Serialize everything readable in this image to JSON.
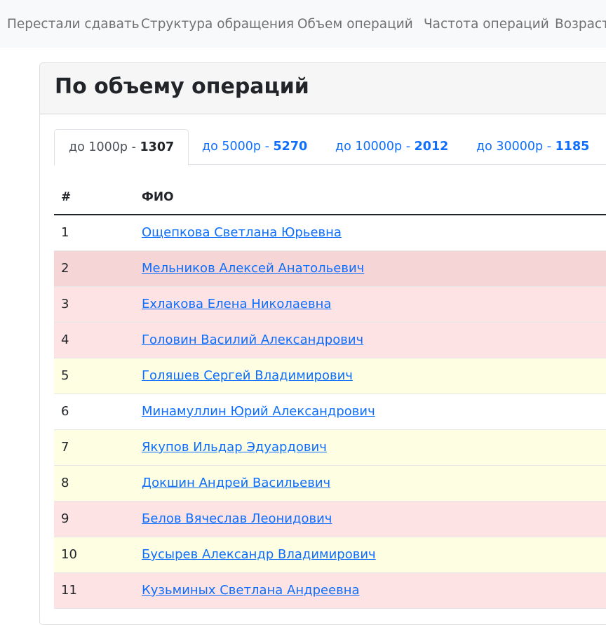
{
  "nav": {
    "items": [
      {
        "label": "Перестали сдавать"
      },
      {
        "label": "Структура обращения"
      },
      {
        "label": "Объем операций"
      },
      {
        "label": "Частота операций"
      },
      {
        "label": "Возраст"
      }
    ]
  },
  "card": {
    "title": "По объему операций"
  },
  "tabs": [
    {
      "label": "до 1000р - ",
      "count": "1307",
      "active": true
    },
    {
      "label": "до 5000р - ",
      "count": "5270",
      "active": false
    },
    {
      "label": "до 10000р - ",
      "count": "2012",
      "active": false
    },
    {
      "label": "до 30000р - ",
      "count": "1185",
      "active": false
    }
  ],
  "table": {
    "headers": [
      "#",
      "ФИО"
    ],
    "rows": [
      {
        "num": "1",
        "name": "Ощепкова Светлана Юрьевна",
        "color": "#ffffff"
      },
      {
        "num": "2",
        "name": "Мельников Алексей Анатольевич",
        "color": "#f5d5d6"
      },
      {
        "num": "3",
        "name": "Ехлакова Елена Николаевна",
        "color": "#fde3e3"
      },
      {
        "num": "4",
        "name": "Головин Василий Александрович",
        "color": "#fde3e3"
      },
      {
        "num": "5",
        "name": "Голяшев Сергей Владимирович",
        "color": "#fefee2"
      },
      {
        "num": "6",
        "name": "Минамуллин Юрий Александрович",
        "color": "#ffffff"
      },
      {
        "num": "7",
        "name": "Якупов Ильдар Эдуардович",
        "color": "#fefee2"
      },
      {
        "num": "8",
        "name": "Докшин Андрей Васильевич",
        "color": "#fefee2"
      },
      {
        "num": "9",
        "name": "Белов Вячеслав Леонидович",
        "color": "#fde3e3"
      },
      {
        "num": "10",
        "name": "Бусырев Александр Владимирович",
        "color": "#fefee2"
      },
      {
        "num": "11",
        "name": "Кузьминых Светлана Андреевна",
        "color": "#fde3e3"
      }
    ]
  },
  "colors": {
    "link": "#0d6efd",
    "nav_bg": "#f8f9fa",
    "row_danger": "#fde3e3",
    "row_danger_hover": "#f5d5d6",
    "row_warning": "#fefee2"
  }
}
